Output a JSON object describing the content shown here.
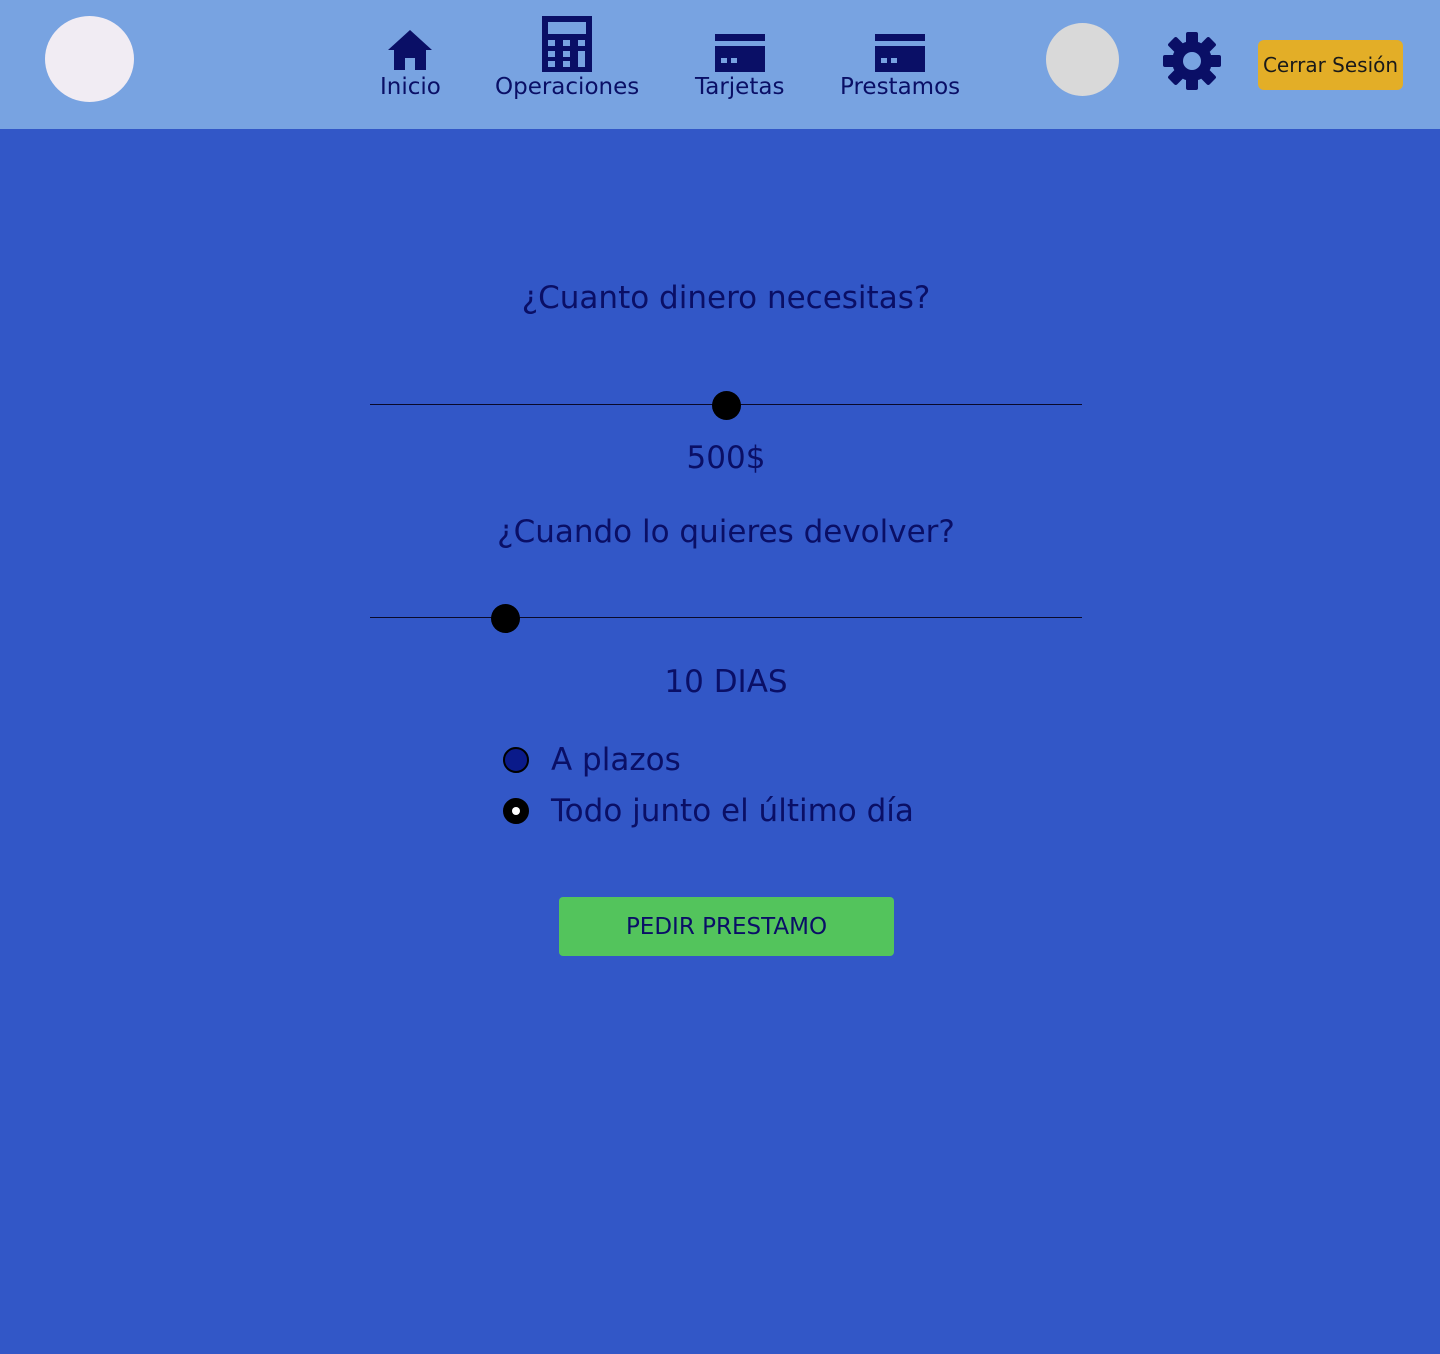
{
  "header": {
    "nav": [
      {
        "label": "Inicio",
        "icon": "home-icon"
      },
      {
        "label": "Operaciones",
        "icon": "calculator-icon"
      },
      {
        "label": "Tarjetas",
        "icon": "credit-card-icon"
      },
      {
        "label": "Prestamos",
        "icon": "credit-card-icon"
      }
    ],
    "logout_label": "Cerrar Sesión"
  },
  "loan_form": {
    "amount_question": "¿Cuanto dinero necesitas?",
    "amount_slider_fraction": 0.5,
    "amount_value": "500$",
    "term_question": "¿Cuando lo quieres devolver?",
    "term_slider_fraction": 0.19,
    "term_value": "10 DIAS",
    "repayment_options": [
      {
        "label": "A plazos",
        "selected": false
      },
      {
        "label": "Todo junto el último día",
        "selected": true
      }
    ],
    "submit_label": "PEDIR PRESTAMO"
  },
  "colors": {
    "background": "#3257c7",
    "topbar": "#78a3e1",
    "text": "#0a0f66",
    "logout_button": "#e3ae27",
    "submit_button": "#53c45c"
  }
}
